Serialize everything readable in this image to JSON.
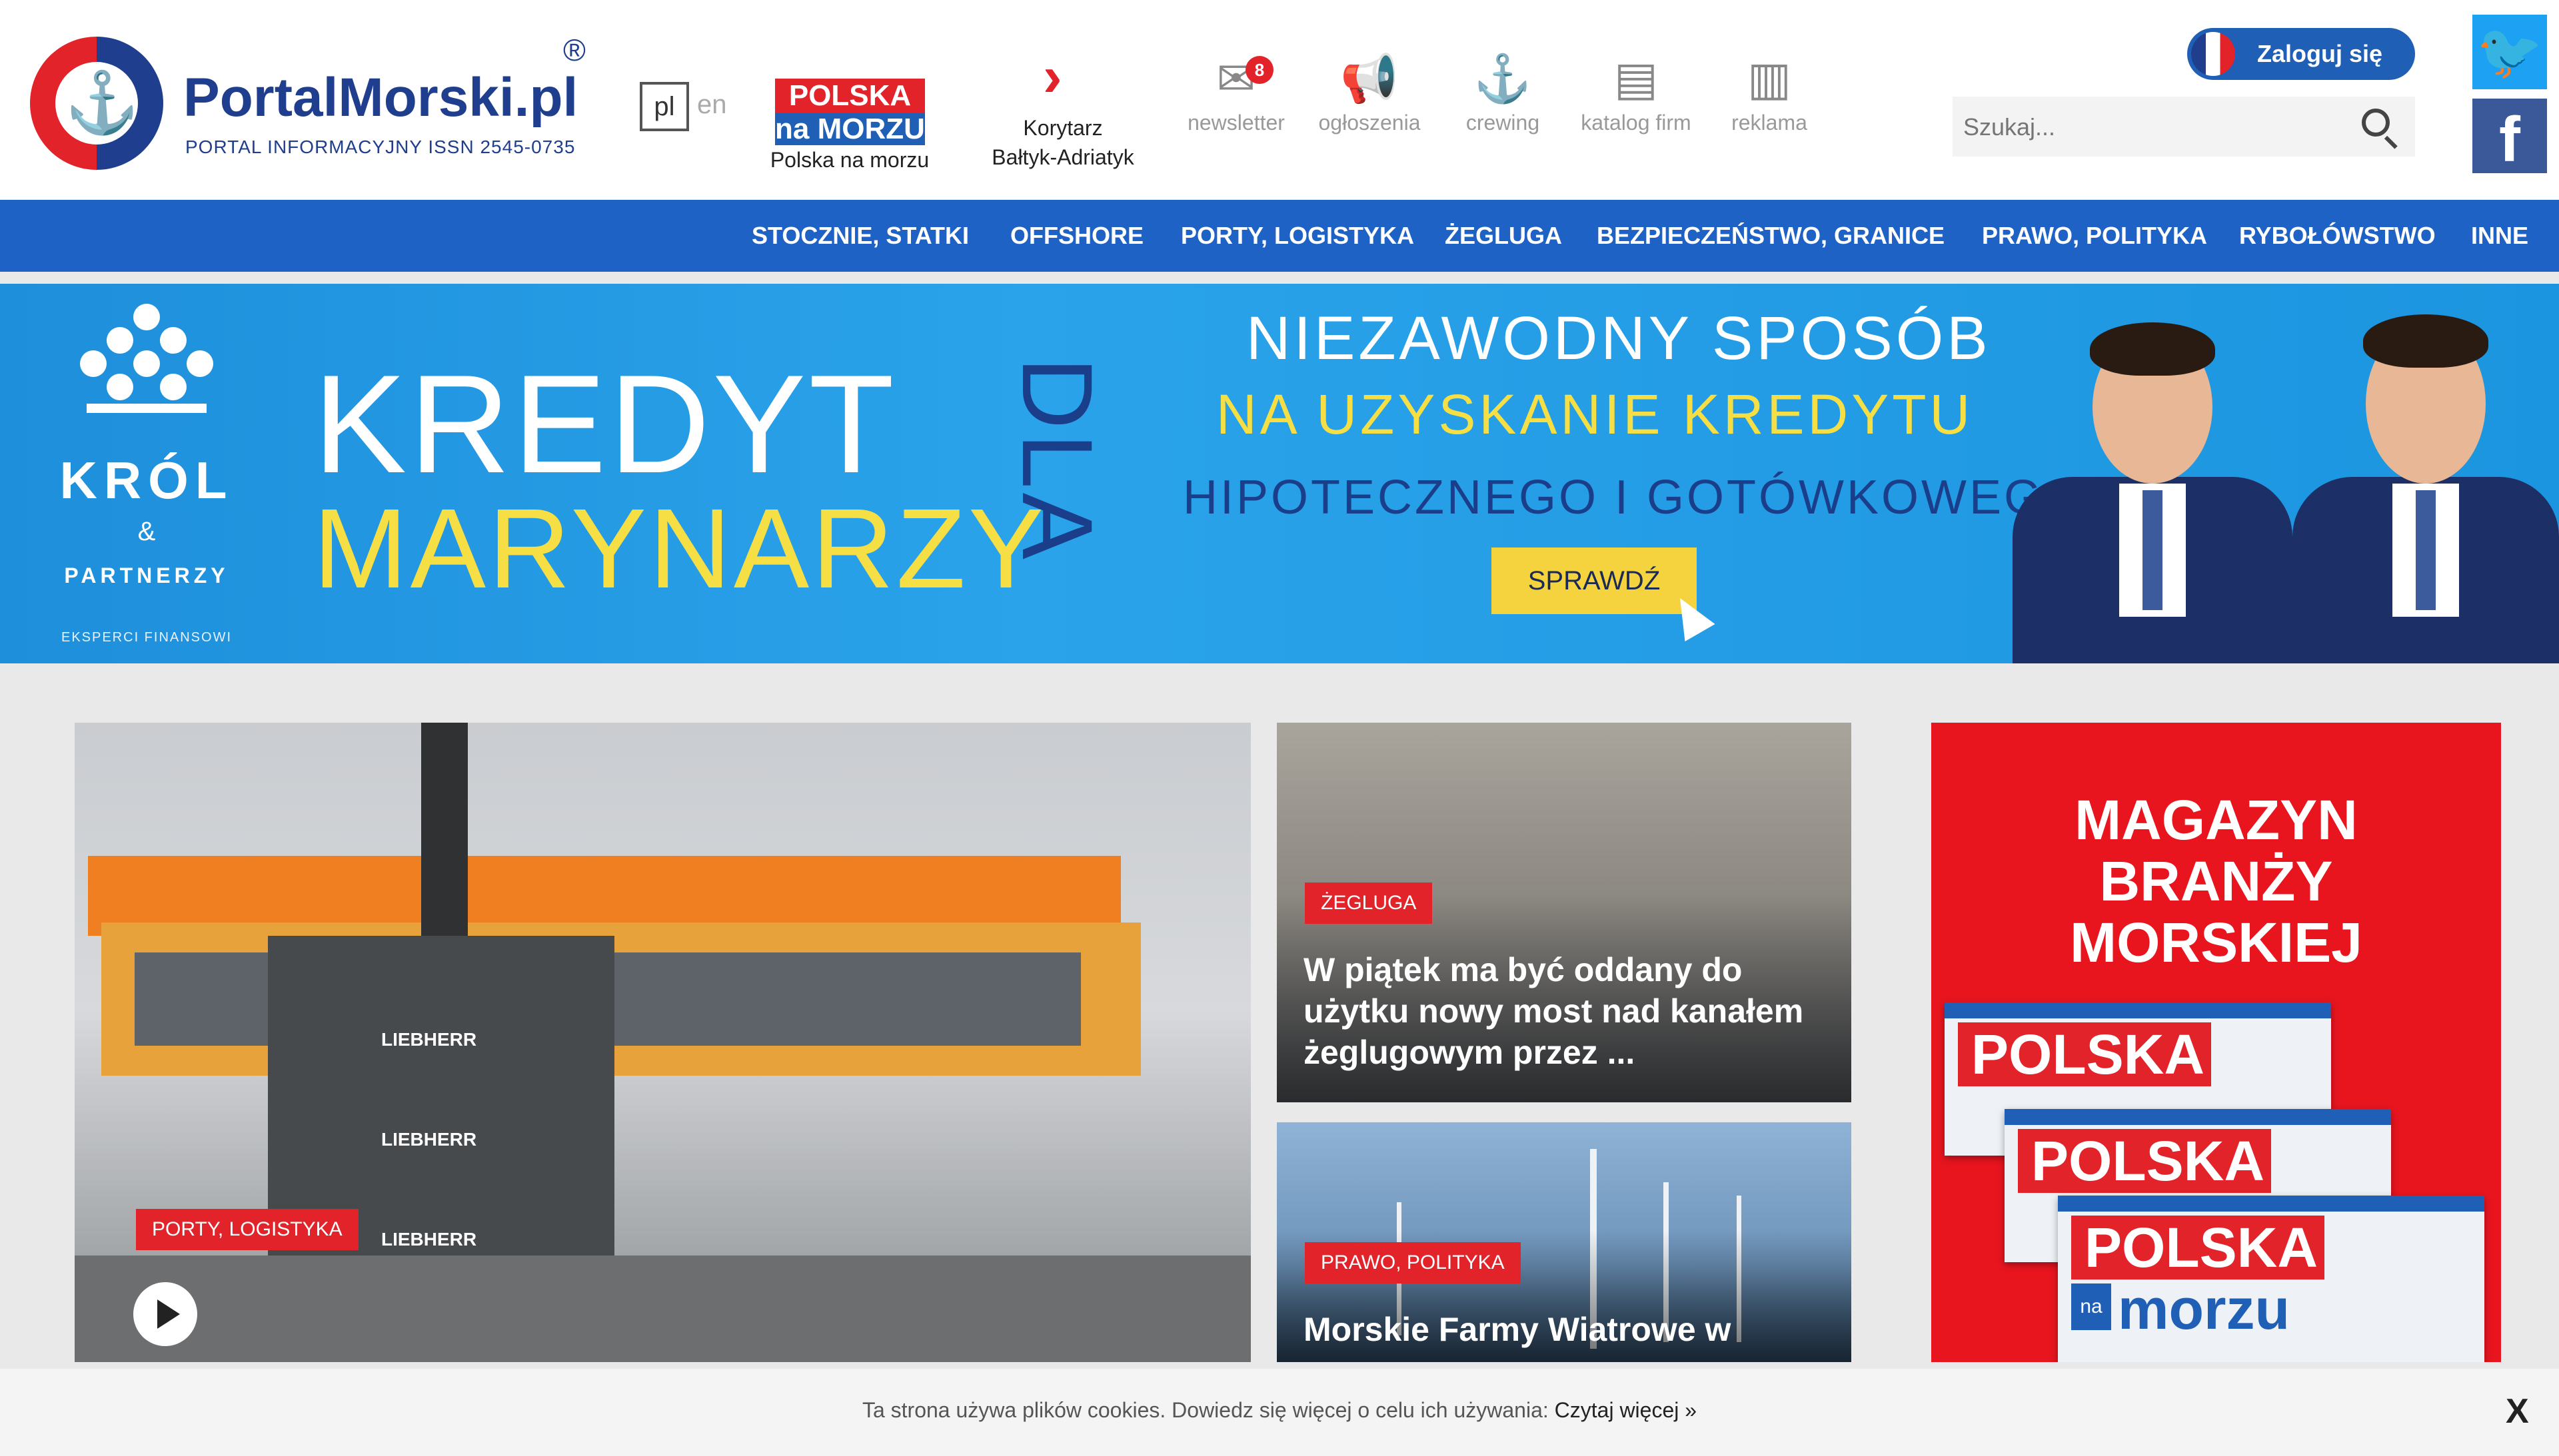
{
  "header": {
    "logo_title": "PortalMorski.pl",
    "logo_registered": "®",
    "logo_subtitle": "PORTAL INFORMACYJNY ISSN 2545-0735",
    "lang_pl": "pl",
    "lang_en": "en",
    "pnm_badge_top": "POLSKA",
    "pnm_badge_bottom": "na MORZU",
    "pnm_label": "Polska na morzu",
    "korytarz_label_1": "Korytarz",
    "korytarz_label_2": "Bałtyk-Adriatyk",
    "nav_icons": [
      {
        "label": "newsletter",
        "icon": "envelope-icon",
        "badge": "8"
      },
      {
        "label": "ogłoszenia",
        "icon": "megaphone-icon"
      },
      {
        "label": "crewing",
        "icon": "anchor-icon"
      },
      {
        "label": "katalog firm",
        "icon": "book-icon"
      },
      {
        "label": "reklama",
        "icon": "chart-icon"
      }
    ],
    "login_label": "Zaloguj się",
    "search_placeholder": "Szukaj..."
  },
  "main_nav": [
    "STOCZNIE, STATKI",
    "OFFSHORE",
    "PORTY, LOGISTYKA",
    "ŻEGLUGA",
    "BEZPIECZEŃSTWO, GRANICE",
    "PRAWO, POLITYKA",
    "RYBOŁÓWSTWO",
    "INNE"
  ],
  "banner": {
    "brand_1": "KRÓL",
    "brand_amp": "&",
    "brand_2": "PARTNERZY",
    "brand_tagline": "EKSPERCI FINANSOWI",
    "headline_1": "KREDYT",
    "headline_2": "MARYNARZY",
    "headline_dla": "DLA",
    "tagline_1": "NIEZAWODNY SPOSÓB",
    "tagline_2": "NA UZYSKANIE KREDYTU",
    "tagline_3": "HIPOTECZNEGO I GOTÓWKOWEGO",
    "cta": "SPRAWDŹ"
  },
  "articles": {
    "main": {
      "category": "PORTY, LOGISTYKA",
      "crane_labels": [
        "LIEBHERR",
        "LIEBHERR",
        "LIEBHERR"
      ]
    },
    "side1": {
      "category": "ŻEGLUGA",
      "title": "W piątek ma być oddany do użytku nowy most nad kanałem żeglugowym przez ..."
    },
    "side2": {
      "category": "PRAWO, POLITYKA",
      "title": "Morskie Farmy Wiatrowe w"
    }
  },
  "magazine_ad": {
    "title_lines": [
      "MAGAZYN",
      "BRANŻY",
      "MORSKIEJ"
    ],
    "cover_name": "POLSKA",
    "cover_na": "na",
    "cover_morzu": "morzu"
  },
  "cookie": {
    "text": "Ta strona używa plików cookies. Dowiedz się więcej o celu ich używania:",
    "link": "Czytaj więcej »",
    "close": "X"
  },
  "colors": {
    "brand_blue": "#1f3e8d",
    "nav_blue": "#1f62c5",
    "accent_red": "#e2232a",
    "banner_yellow": "#f5df45"
  }
}
